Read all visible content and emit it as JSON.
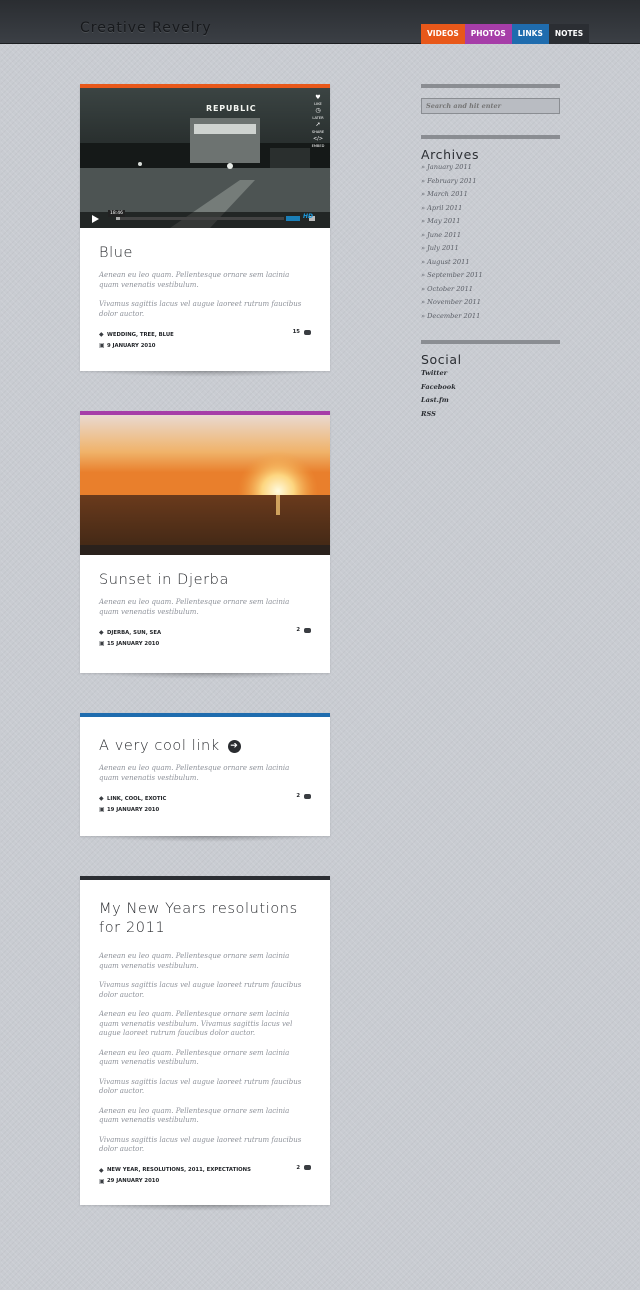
{
  "site": {
    "title": "Creative Revelry"
  },
  "nav": [
    {
      "label": "VIDEOS",
      "color": "#e8581a"
    },
    {
      "label": "PHOTOS",
      "color": "#a63da8"
    },
    {
      "label": "LINKS",
      "color": "#1f6cae"
    },
    {
      "label": "NOTES",
      "color": "#2b2e33"
    }
  ],
  "posts": [
    {
      "type": "video",
      "accent": "#e8581a",
      "title": "Blue",
      "paragraphs": [
        "Aenean eu leo quam. Pellentesque ornare sem lacinia quam venenatis vestibulum.",
        "Vivamus sagittis lacus vel augue laoreet rutrum faucibus dolor auctor."
      ],
      "tags": "WEDDING, TREE, BLUE",
      "date": "9 JANUARY 2010",
      "comments": "15",
      "video": {
        "sign": "REPUBLIC",
        "time": "18:46",
        "side_buttons": [
          "LIKE",
          "LATER",
          "SHARE",
          "EMBED"
        ],
        "hd_label": "HD"
      }
    },
    {
      "type": "photo",
      "accent": "#a63da8",
      "title": "Sunset in Djerba",
      "paragraphs": [
        "Aenean eu leo quam. Pellentesque ornare sem lacinia quam venenatis vestibulum."
      ],
      "tags": "DJERBA, SUN, SEA",
      "date": "15 JANUARY 2010",
      "comments": "2"
    },
    {
      "type": "link",
      "accent": "#1f6cae",
      "title": "A very cool link",
      "paragraphs": [
        "Aenean eu leo quam. Pellentesque ornare sem lacinia quam venenatis vestibulum."
      ],
      "tags": "LINK, COOL, EXOTIC",
      "date": "19 JANUARY 2010",
      "comments": "2"
    },
    {
      "type": "note",
      "accent": "#2b2e33",
      "title_line1": "My New Years resolutions",
      "title_line2": "for 2011",
      "paragraphs": [
        "Aenean eu leo quam. Pellentesque ornare sem lacinia quam venenatis vestibulum.",
        "Vivamus sagittis lacus vel augue laoreet rutrum faucibus dolor auctor.",
        "Aenean eu leo quam. Pellentesque ornare sem lacinia quam venenatis vestibulum. Vivamus sagittis lacus vel augue laoreet rutrum faucibus dolor auctor.",
        "Aenean eu leo quam. Pellentesque ornare sem lacinia quam venenatis vestibulum.",
        "Vivamus sagittis lacus vel augue laoreet rutrum faucibus dolor auctor.",
        "Aenean eu leo quam. Pellentesque ornare sem lacinia quam venenatis vestibulum.",
        "Vivamus sagittis lacus vel augue laoreet rutrum faucibus dolor auctor."
      ],
      "tags": "NEW YEAR, RESOLUTIONS, 2011, EXPECTATIONS",
      "date": "29 JANUARY 2010",
      "comments": "2"
    }
  ],
  "sidebar": {
    "search_placeholder": "Search and hit enter",
    "archives_title": "Archives",
    "archives": [
      "» January 2011",
      "» February 2011",
      "» March 2011",
      "» April 2011",
      "» May 2011",
      "» June 2011",
      "» July 2011",
      "» August 2011",
      "» September 2011",
      "» October 2011",
      "» November 2011",
      "» December 2011"
    ],
    "social_title": "Social",
    "social": [
      "Twitter",
      "Facebook",
      "Last.fm",
      "RSS"
    ]
  },
  "icons": {
    "tag": "tag-icon",
    "calendar": "calendar-icon",
    "comment": "comment-bubble-icon",
    "play": "play-icon",
    "link": "link-arrow-icon"
  }
}
